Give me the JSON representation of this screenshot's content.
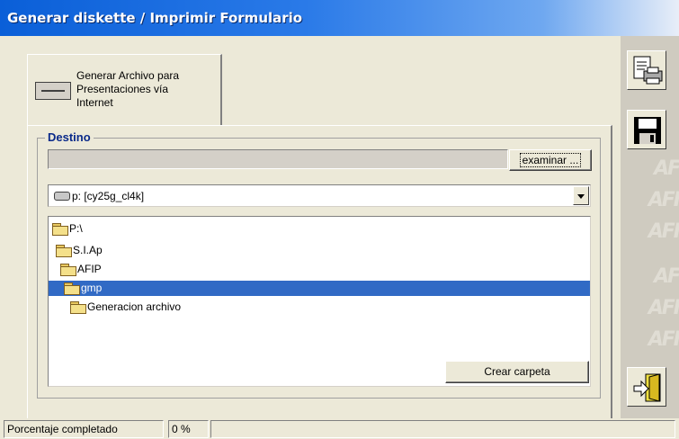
{
  "window": {
    "title": "Generar diskette / Imprimir Formulario"
  },
  "tab": {
    "label": "Generar Archivo para\nPresentaciones vía\nInternet"
  },
  "group": {
    "title": "Destino"
  },
  "path": {
    "value": ""
  },
  "buttons": {
    "browse": "examinar ...",
    "create_folder": "Crear carpeta"
  },
  "drive": {
    "selected": "p: [cy25g_cl4k]"
  },
  "tree": {
    "items": [
      {
        "label": "P:\\",
        "open": true,
        "selected": false
      },
      {
        "label": "S.I.Ap",
        "open": true,
        "selected": false
      },
      {
        "label": "AFIP",
        "open": true,
        "selected": false
      },
      {
        "label": "gmp",
        "open": true,
        "selected": true
      },
      {
        "label": "Generacion archivo",
        "open": false,
        "selected": false
      }
    ]
  },
  "side_buttons": {
    "icons": [
      "print-form-icon",
      "save-disk-icon",
      "exit-door-icon"
    ]
  },
  "status": {
    "label": "Porcentaje completado",
    "percent": "0 %"
  },
  "colors": {
    "title_bar": "#0a5fd8",
    "selection": "#316ac5",
    "group_title": "#0a2a8a"
  }
}
